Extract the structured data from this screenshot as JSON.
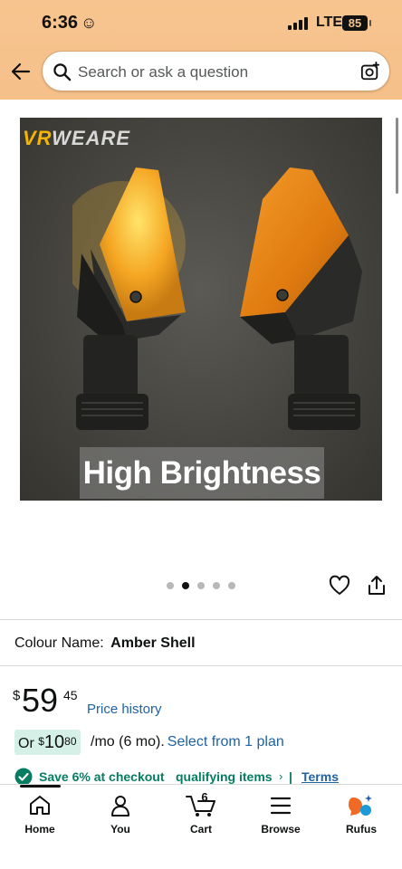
{
  "status_bar": {
    "time": "6:36",
    "network": "LTE",
    "battery": "85"
  },
  "search": {
    "placeholder": "Search or ask a question"
  },
  "product_image": {
    "brand_logo_vr": "VR",
    "brand_logo_rest": "WEARE",
    "overlay_text": "High Brightness",
    "carousel_dots": 5,
    "active_dot": 1
  },
  "colour": {
    "label": "Colour Name:",
    "value": "Amber Shell"
  },
  "price": {
    "currency": "$",
    "whole": "59",
    "fraction": "45",
    "history_link": "Price history"
  },
  "installment": {
    "prefix": "Or",
    "currency": "$",
    "amount_whole": "10",
    "amount_fraction": "80",
    "suffix": "/mo (6 mo).",
    "plan_link": "Select from 1 plan"
  },
  "savings": {
    "text": "Save 6% at checkout",
    "qualifying": "qualifying items",
    "chevron": "›",
    "separator": "|",
    "terms": "Terms"
  },
  "bottom_nav": {
    "items": [
      {
        "label": "Home",
        "icon": "home-icon"
      },
      {
        "label": "You",
        "icon": "person-icon"
      },
      {
        "label": "Cart",
        "icon": "cart-icon",
        "count": "6"
      },
      {
        "label": "Browse",
        "icon": "menu-icon"
      },
      {
        "label": "Rufus",
        "icon": "rufus-icon"
      }
    ]
  },
  "colors": {
    "header_bg": "#f7c48f",
    "link": "#2162a1",
    "deal_green": "#067d62",
    "installment_bg": "#d4f0e7"
  }
}
